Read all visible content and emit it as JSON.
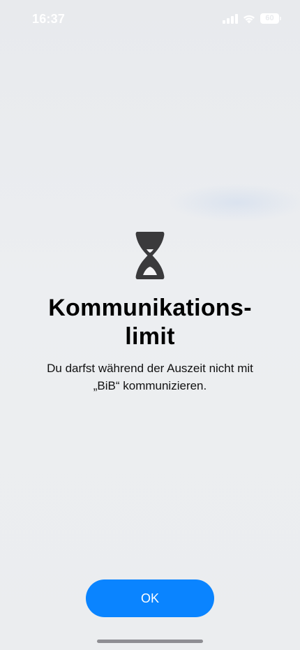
{
  "status_bar": {
    "time": "16:37",
    "battery_percent": "60",
    "signal_icon": "cellular-signal-icon",
    "wifi_icon": "wifi-icon"
  },
  "alert": {
    "icon": "hourglass-icon",
    "title": "Kommunikations-limit",
    "message": "Du darfst während der Auszeit nicht mit „BiB“ kommunizieren.",
    "ok_label": "OK"
  },
  "colors": {
    "accent": "#0a84ff",
    "icon": "#3a3a3c",
    "background": "#e9ebee"
  }
}
